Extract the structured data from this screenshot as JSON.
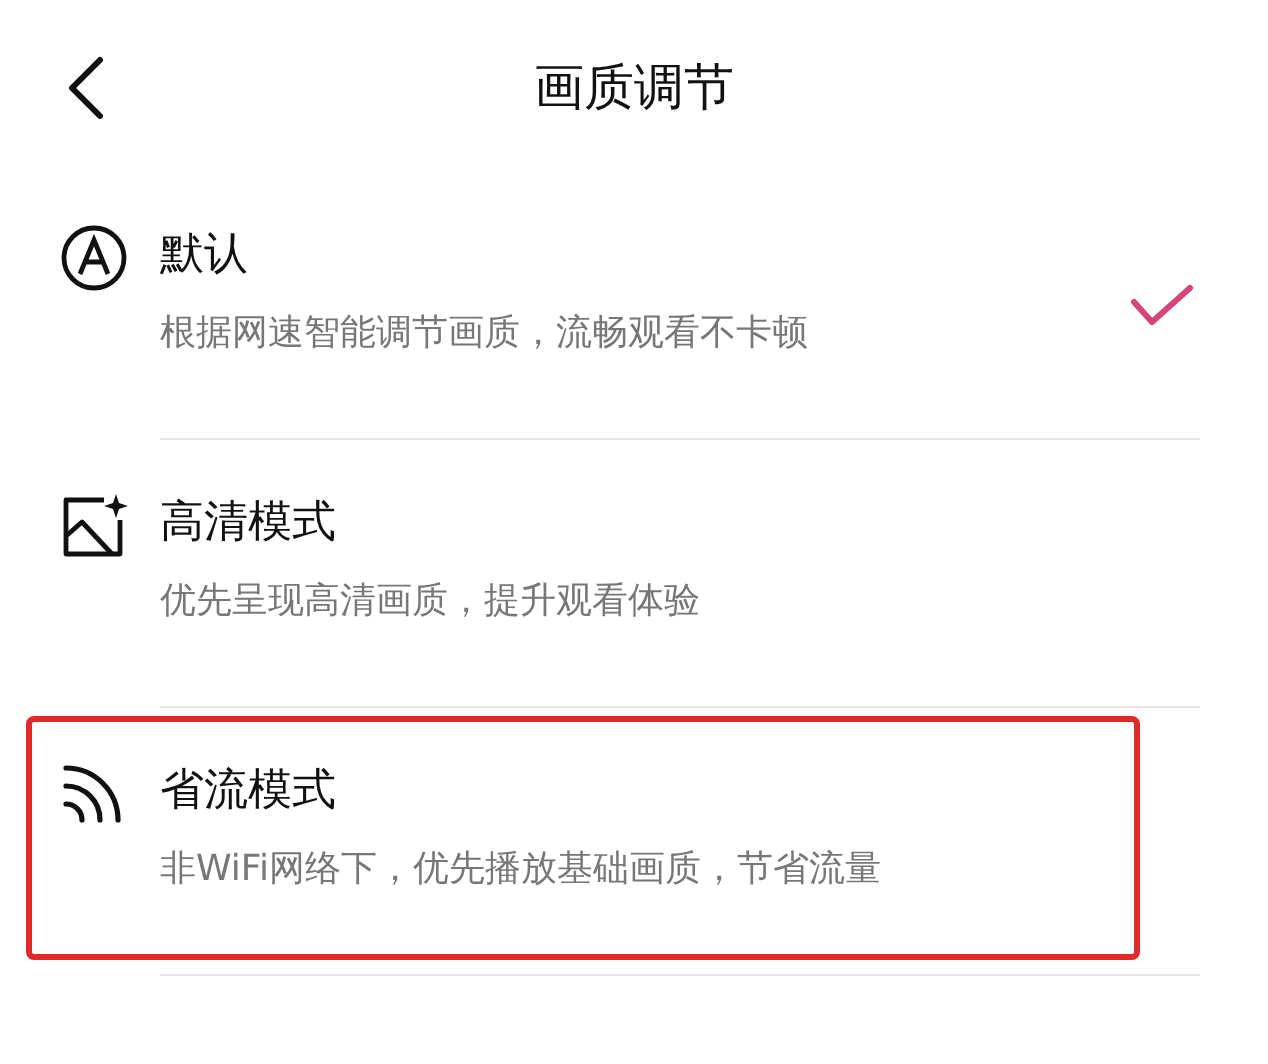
{
  "header": {
    "title": "画质调节"
  },
  "options": [
    {
      "kind": "auto",
      "title": "默认",
      "description": "根据网速智能调节画质，流畅观看不卡顿",
      "selected": true,
      "highlighted": false
    },
    {
      "kind": "hd",
      "title": "高清模式",
      "description": "优先呈现高清画质，提升观看体验",
      "selected": false,
      "highlighted": false
    },
    {
      "kind": "saver",
      "title": "省流模式",
      "description": "非WiFi网络下，优先播放基础画质，节省流量",
      "selected": false,
      "highlighted": true
    }
  ]
}
